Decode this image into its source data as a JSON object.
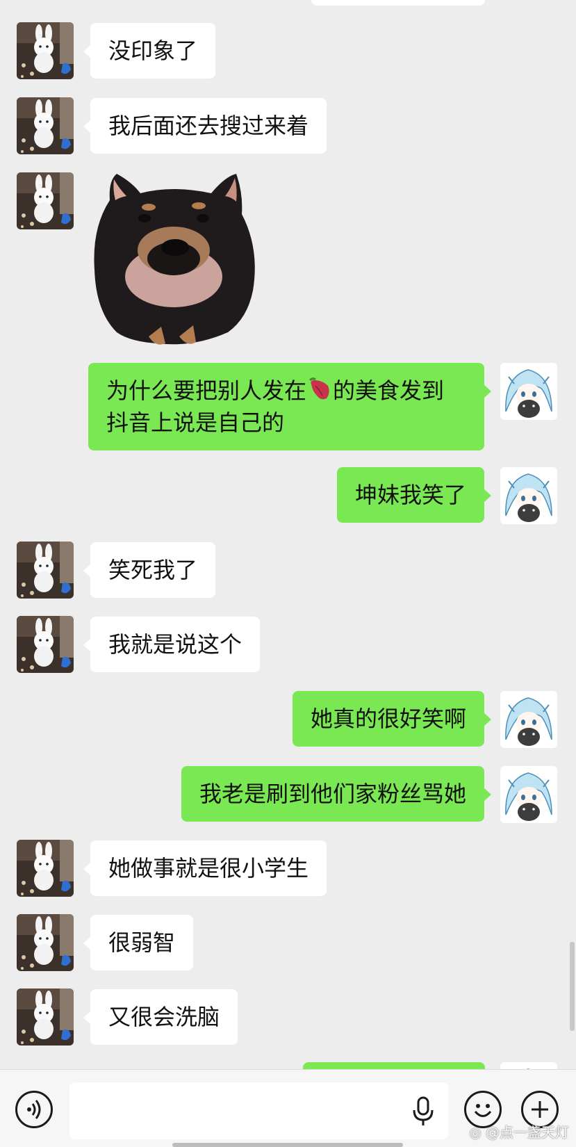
{
  "app": "WeChat chat",
  "colors": {
    "background": "#ededed",
    "outgoing_bubble": "#79e852",
    "incoming_bubble": "#ffffff",
    "input_bar": "#f6f6f6"
  },
  "avatars": {
    "contact": "bunny-plush-avatar",
    "self": "anime-girl-avatar"
  },
  "messages": [
    {
      "side": "left",
      "text": "没印象了"
    },
    {
      "side": "left",
      "text": "我后面还去搜过来着"
    },
    {
      "side": "left",
      "type": "sticker",
      "sticker": "shiba-dog-sticker"
    },
    {
      "side": "right",
      "line1_before": "为什么要把别人发在",
      "emoji": "sweet-potato-emoji",
      "line1_after": "的美食发到",
      "line2": "抖音上说是自己的"
    },
    {
      "side": "right",
      "text": "坤妹我笑了"
    },
    {
      "side": "left",
      "text": "笑死我了"
    },
    {
      "side": "left",
      "text": "我就是说这个"
    },
    {
      "side": "right",
      "text": "她真的很好笑啊"
    },
    {
      "side": "right",
      "text": "我老是刷到他们家粉丝骂她"
    },
    {
      "side": "left",
      "text": "她做事就是很小学生"
    },
    {
      "side": "left",
      "text": "很弱智"
    },
    {
      "side": "left",
      "text": "又很会洗脑"
    }
  ],
  "input_bar": {
    "voice_button": "voice-icon",
    "input_placeholder": "",
    "mic_icon": "microphone-icon",
    "emoji_button": "smiley-icon",
    "more_button": "plus-icon"
  },
  "watermark": "@点一盏天灯"
}
